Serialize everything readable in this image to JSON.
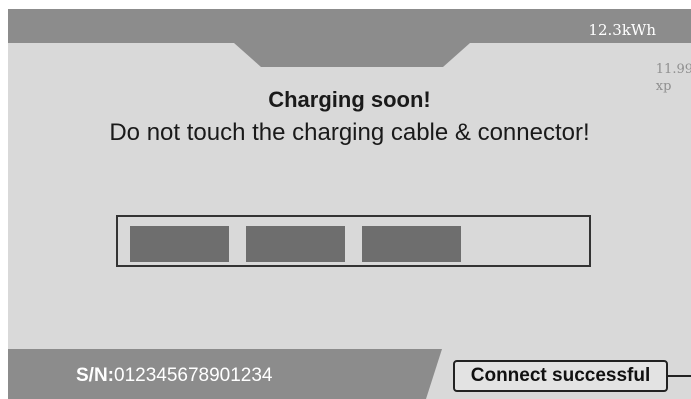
{
  "header": {
    "energy": "12.3kWh",
    "price_value": "11.99",
    "price_unit": "xp"
  },
  "notice": {
    "title": "Charging soon!",
    "message": "Do not touch the charging cable & connector!"
  },
  "progress": {
    "filled_segments": 3,
    "total_segments": 4
  },
  "footer": {
    "sn_label": "S/N:",
    "sn_value": "012345678901234",
    "status": "Connect successful"
  },
  "colors": {
    "screen_bg": "#d9d9d9",
    "bar_gray": "#8c8c8c",
    "segment_fill": "#6e6e6e"
  }
}
